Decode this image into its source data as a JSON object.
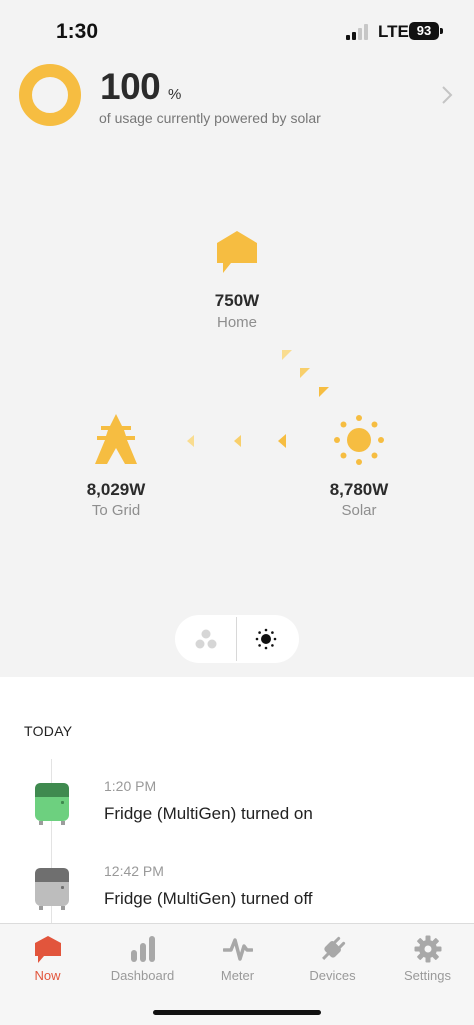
{
  "status_bar": {
    "time": "1:30",
    "network": "LTE",
    "battery": "93"
  },
  "summary": {
    "percent": "100",
    "percent_unit": "%",
    "subtitle": "of usage currently powered by solar",
    "ring_color": "#f6bd41"
  },
  "flow": {
    "home": {
      "value": "750W",
      "label": "Home",
      "icon": "home-icon"
    },
    "grid": {
      "value": "8,029W",
      "label": "To Grid",
      "icon": "power-tower-icon"
    },
    "solar": {
      "value": "8,780W",
      "label": "Solar",
      "icon": "sun-icon"
    }
  },
  "view_toggle": {
    "options": [
      "devices-icon",
      "sun-icon"
    ],
    "selected": "sun-icon"
  },
  "feed": {
    "section_title": "TODAY",
    "events": [
      {
        "time": "1:20 PM",
        "text": "Fridge (MultiGen) turned on",
        "status_color": "#6dd07f"
      },
      {
        "time": "12:42 PM",
        "text": "Fridge (MultiGen) turned off",
        "status_color": "#bdbdbd"
      }
    ]
  },
  "tabs": [
    {
      "label": "Now",
      "icon": "now-icon",
      "active": true
    },
    {
      "label": "Dashboard",
      "icon": "dashboard-icon"
    },
    {
      "label": "Meter",
      "icon": "meter-icon"
    },
    {
      "label": "Devices",
      "icon": "plug-icon"
    },
    {
      "label": "Settings",
      "icon": "gear-icon"
    }
  ],
  "colors": {
    "accent": "#f6bd41",
    "active_tab": "#e2553c",
    "muted": "#9a9a9a"
  }
}
